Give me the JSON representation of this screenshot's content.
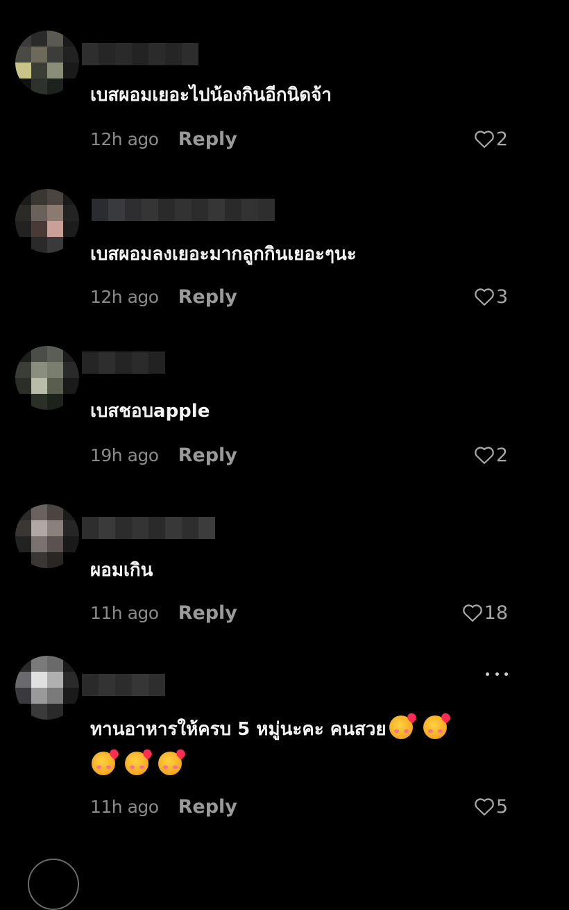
{
  "theme": {
    "background": "#000000",
    "text": "#f4f4f4",
    "muted": "#8a8a8a",
    "reply": "#9a9a9a"
  },
  "comments": [
    {
      "text": "เบสผอมเยอะไปน้องกินอีกนิดจ้า",
      "time": "12h ago",
      "reply_label": "Reply",
      "likes": "2"
    },
    {
      "text": "เบสผอมลงเยอะมากลูกกินเยอะๆนะ",
      "time": "12h ago",
      "reply_label": "Reply",
      "likes": "3"
    },
    {
      "text": "เบสชอบapple",
      "time": "19h ago",
      "reply_label": "Reply",
      "likes": "2"
    },
    {
      "text": "ผอมเกิน",
      "time": "11h ago",
      "reply_label": "Reply",
      "likes": "18"
    },
    {
      "text_line1": "ทานอาหารให้ครบ 5 หมู่นะคะ คนสวย",
      "emoji": "smiling-face-with-hearts-emoji",
      "time": "11h ago",
      "reply_label": "Reply",
      "likes": "5"
    }
  ]
}
